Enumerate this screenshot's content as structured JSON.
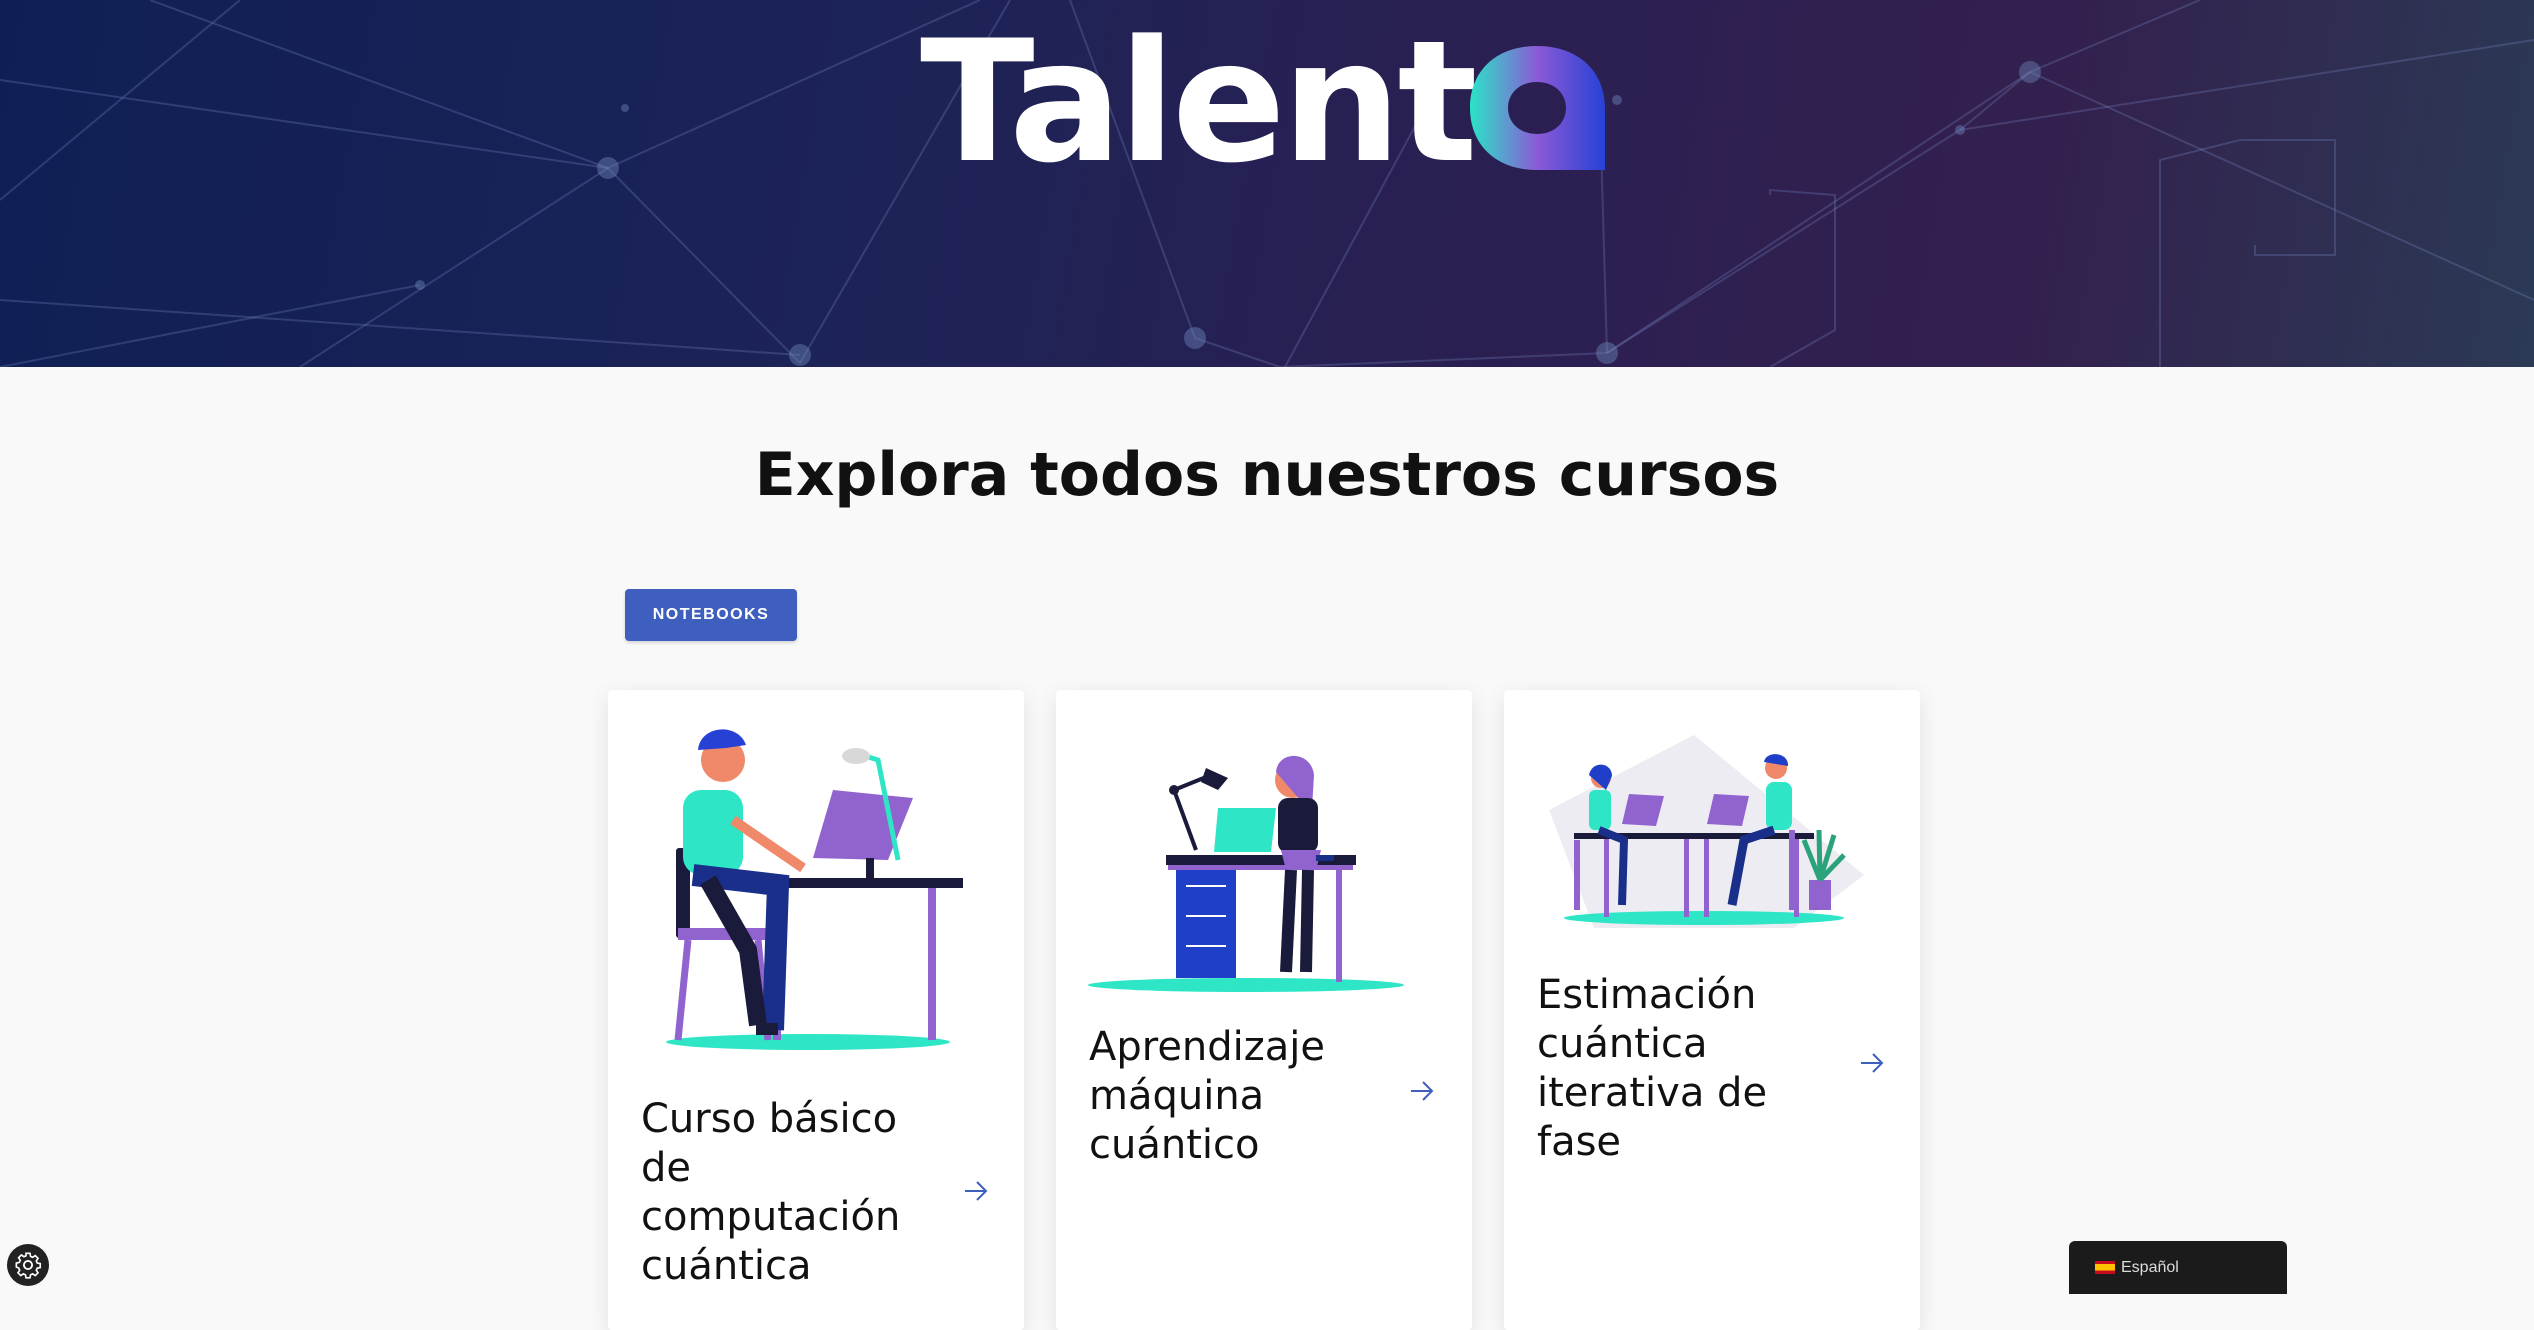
{
  "header": {
    "logo_text": "Talent",
    "logo_letter": "Q",
    "background_colors": [
      "#0f1f55",
      "#33204e"
    ]
  },
  "main": {
    "heading": "Explora todos nuestros cursos",
    "filter_label": "NOTEBOOKS",
    "courses": [
      {
        "title": "Curso básico de computación cuántica",
        "arrow_icon": "arrow-right-icon",
        "image": "man-at-computer-illustration"
      },
      {
        "title": "Aprendizaje máquina cuántico",
        "arrow_icon": "arrow-right-icon",
        "image": "woman-at-laptop-illustration"
      },
      {
        "title": "Estimación cuántica iterativa de fase",
        "arrow_icon": "arrow-right-icon",
        "image": "two-people-at-computers-illustration"
      }
    ]
  },
  "widgets": {
    "settings_icon": "gear-icon",
    "language_label": "Español",
    "language_flag": "spain-flag-icon"
  },
  "colors": {
    "accent": "#3f5fbf",
    "teal": "#2ee6c5",
    "purple": "#9163cf",
    "navy": "#1a2f8a"
  }
}
